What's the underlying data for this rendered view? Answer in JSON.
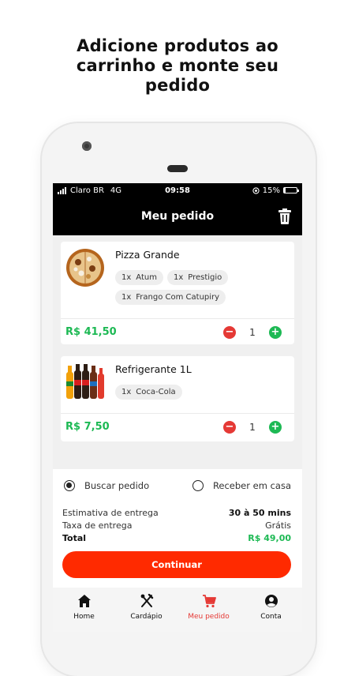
{
  "headline": {
    "line1": "Adicione produtos ao",
    "line2": "carrinho e monte seu",
    "line3": "pedido"
  },
  "status_bar": {
    "carrier": "Claro BR",
    "network": "4G",
    "time": "09:58",
    "battery": "15%",
    "battery_level": 0.15
  },
  "app_bar": {
    "title": "Meu pedido",
    "trash_icon": "trash-icon"
  },
  "cart": [
    {
      "name": "Pizza Grande",
      "image": "pizza-image",
      "options": [
        {
          "qty": "1x",
          "label": "Atum"
        },
        {
          "qty": "1x",
          "label": "Prestigio"
        },
        {
          "qty": "1x",
          "label": "Frango Com Catupiry"
        }
      ],
      "price": "R$ 41,50",
      "quantity": "1"
    },
    {
      "name": "Refrigerante 1L",
      "image": "soda-bottles-image",
      "options": [
        {
          "qty": "1x",
          "label": "Coca-Cola"
        }
      ],
      "price": "R$ 7,50",
      "quantity": "1"
    }
  ],
  "stepper": {
    "minus": "−",
    "plus": "+"
  },
  "delivery": {
    "pickup_label": "Buscar pedido",
    "home_label": "Receber em casa",
    "selected": "pickup"
  },
  "summary": {
    "estimate_label": "Estimativa de entrega",
    "estimate_value": "30 à 50 mins",
    "fee_label": "Taxa de entrega",
    "fee_value": "Grátis",
    "total_label": "Total",
    "total_value": "R$ 49,00"
  },
  "continue_label": "Continuar",
  "tabs": [
    {
      "label": "Home",
      "icon": "home-icon"
    },
    {
      "label": "Cardápio",
      "icon": "utensils-icon"
    },
    {
      "label": "Meu pedido",
      "icon": "cart-icon",
      "active": true
    },
    {
      "label": "Conta",
      "icon": "account-icon"
    }
  ],
  "colors": {
    "accent": "#ff2a00",
    "price_green": "#1db954",
    "minus_red": "#e53935",
    "header_black": "#000000"
  }
}
